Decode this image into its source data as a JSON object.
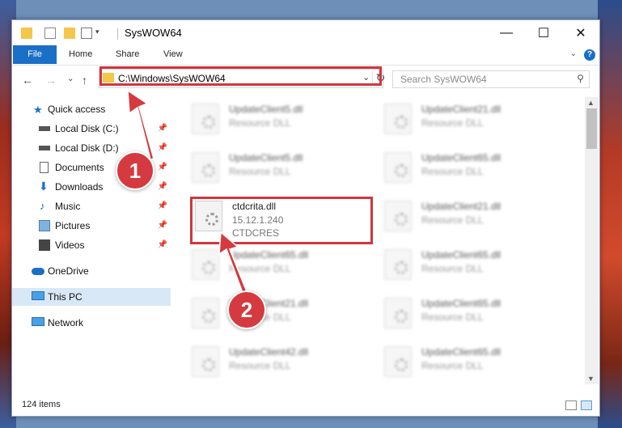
{
  "window": {
    "title": "SysWOW64",
    "minimize": "—",
    "maximize": "☐",
    "close": "✕"
  },
  "ribbon": {
    "tabs": [
      "File",
      "Home",
      "Share",
      "View"
    ],
    "help": "?",
    "collapse": "⌄"
  },
  "address": {
    "path": "C:\\Windows\\SysWOW64",
    "dropdown": "⌄",
    "refresh": "↻"
  },
  "nav": {
    "back": "←",
    "forward": "→",
    "recent": "⌄",
    "up": "↑"
  },
  "search": {
    "placeholder": "Search SysWOW64",
    "icon": "⚲"
  },
  "sidebar": {
    "items": [
      {
        "label": "Quick access",
        "icon": "star-icon"
      },
      {
        "label": "Local Disk (C:)",
        "icon": "drive-icon"
      },
      {
        "label": "Local Disk (D:)",
        "icon": "drive-icon"
      },
      {
        "label": "Documents",
        "icon": "documents-icon"
      },
      {
        "label": "Downloads",
        "icon": "download-icon"
      },
      {
        "label": "Music",
        "icon": "music-icon"
      },
      {
        "label": "Pictures",
        "icon": "pictures-icon"
      },
      {
        "label": "Videos",
        "icon": "videos-icon"
      },
      {
        "label": "OneDrive",
        "icon": "cloud-icon"
      },
      {
        "label": "This PC",
        "icon": "computer-icon"
      },
      {
        "label": "Network",
        "icon": "network-icon"
      }
    ]
  },
  "files": {
    "left": [
      {
        "name": "UpdateClient5.dll",
        "desc": "Resource DLL"
      },
      {
        "name": "UpdateClient5.dll",
        "desc": "Resource DLL"
      },
      {
        "name": "ctdcrita.dll",
        "desc": "15.12.1.240",
        "desc2": "CTDCRES"
      },
      {
        "name": "UpdateClient65.dll",
        "desc": "Resource DLL"
      },
      {
        "name": "UpdateClient21.dll",
        "desc": "Resource DLL"
      },
      {
        "name": "UpdateClient42.dll",
        "desc": "Resource DLL"
      }
    ],
    "right": [
      {
        "name": "UpdateClient21.dll",
        "desc": "Resource DLL"
      },
      {
        "name": "UpdateClient65.dll",
        "desc": "Resource DLL"
      },
      {
        "name": "UpdateClient21.dll",
        "desc": "Resource DLL"
      },
      {
        "name": "UpdateClient65.dll",
        "desc": "Resource DLL"
      },
      {
        "name": "UpdateClient65.dll",
        "desc": "Resource DLL"
      },
      {
        "name": "UpdateClient65.dll",
        "desc": "Resource DLL"
      }
    ]
  },
  "status": {
    "count": "124 items"
  },
  "callouts": [
    "1",
    "2"
  ],
  "colors": {
    "accent": "#1a6fc6",
    "highlight": "#d2363d",
    "selected": "#d9e8f7"
  }
}
